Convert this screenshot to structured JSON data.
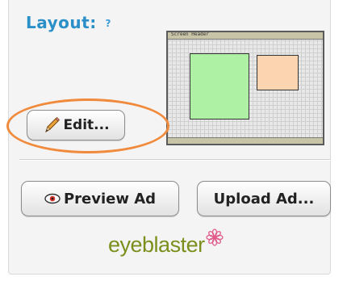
{
  "layout_section": {
    "label": "Layout:",
    "help_icon_glyph": "?",
    "thumbnail": {
      "title_text": "Screen Header",
      "green_color": "#aef0a4",
      "orange_color": "#fcd5b0"
    }
  },
  "buttons": {
    "edit_label": "Edit...",
    "preview_label": "Preview Ad",
    "upload_label": "Upload Ad..."
  },
  "logo": {
    "text": "eyeblaster",
    "text_color": "#7a8f1c",
    "flower_color": "#e05a8a"
  },
  "colors": {
    "label_blue": "#2b8fc8",
    "highlight_orange": "#f08a3c"
  }
}
